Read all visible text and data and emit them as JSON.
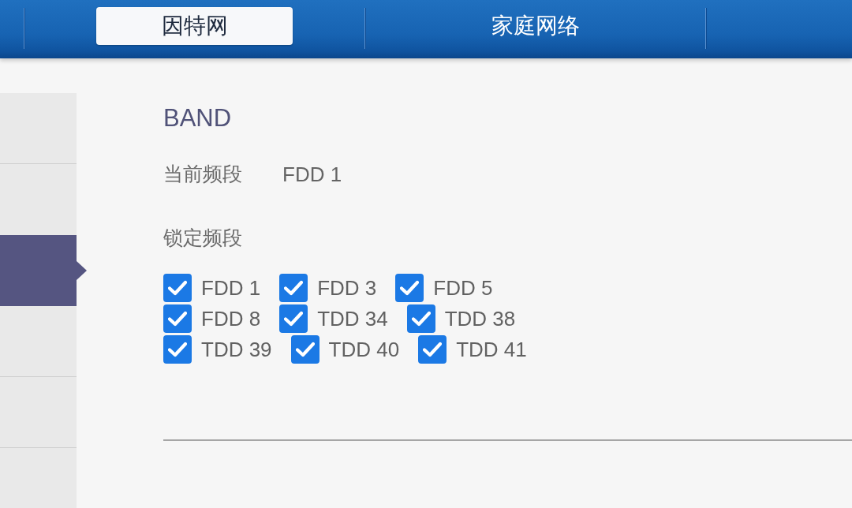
{
  "tabs": [
    {
      "label": "因特网",
      "selected": true
    },
    {
      "label": "家庭网络",
      "selected": false
    }
  ],
  "sidebar": {
    "items": [
      {
        "selected": false
      },
      {
        "selected": false
      },
      {
        "selected": true
      },
      {
        "selected": false
      },
      {
        "selected": false
      },
      {
        "selected": false
      }
    ]
  },
  "band": {
    "title": "BAND",
    "current": {
      "label": "当前频段",
      "value": "FDD 1"
    },
    "locked": {
      "label": "锁定频段",
      "rows": [
        [
          {
            "label": "FDD 1",
            "checked": true
          },
          {
            "label": "FDD 3",
            "checked": true
          },
          {
            "label": "FDD 5",
            "checked": true
          }
        ],
        [
          {
            "label": "FDD 8",
            "checked": true
          },
          {
            "label": "TDD 34",
            "checked": true
          },
          {
            "label": "TDD 38",
            "checked": true
          }
        ],
        [
          {
            "label": "TDD 39",
            "checked": true
          },
          {
            "label": "TDD 40",
            "checked": true
          },
          {
            "label": "TDD 41",
            "checked": true
          }
        ]
      ]
    }
  }
}
